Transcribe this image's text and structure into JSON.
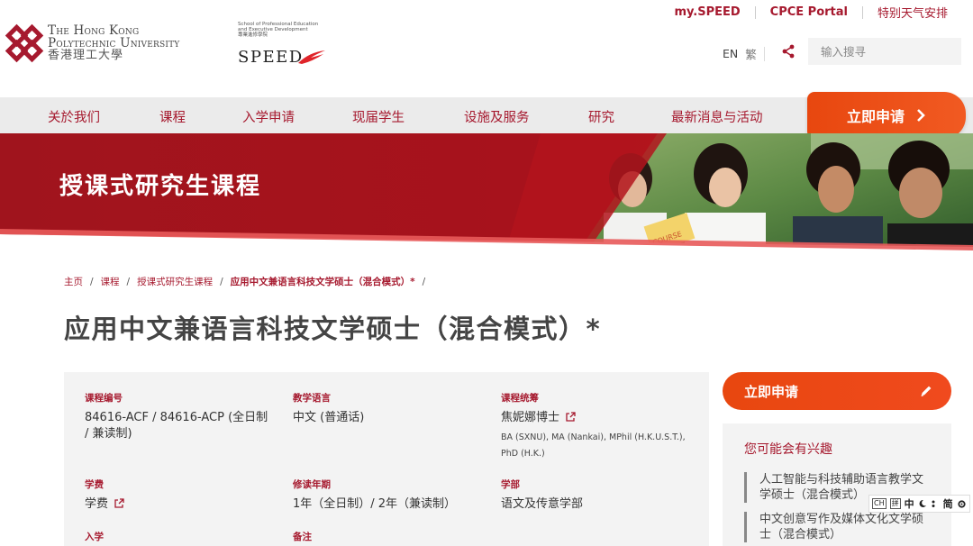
{
  "top_links": [
    "my.SPEED",
    "CPCE Portal",
    "特别天气安排"
  ],
  "logo": {
    "en_line1": "The Hong Kong",
    "en_line2": "Polytechnic University",
    "zh": "香港理工大學"
  },
  "speed": {
    "line1": "School of Professional Education",
    "line2": "and Executive Development",
    "line3": "專業進修學院",
    "word": "SPEED"
  },
  "lang": {
    "en": "EN",
    "zh": "繁"
  },
  "search": {
    "placeholder": "输入搜寻"
  },
  "nav": [
    "关於我们",
    "课程",
    "入学申请",
    "现届学生",
    "设施及服务",
    "研究",
    "最新消息与活动"
  ],
  "apply_tab": "立即申请",
  "banner": {
    "title": "授课式研究生课程",
    "book_text": "COURSE"
  },
  "breadcrumb": [
    "主页",
    "课程",
    "授课式研究生课程",
    "应用中文兼语言科技文学硕士（混合模式）*"
  ],
  "page_title": "应用中文兼语言科技文学硕士（混合模式）*",
  "info": {
    "code_label": "课程编号",
    "code_value": "84616-ACF / 84616-ACP (全日制 / 兼读制)",
    "lang_label": "教学语言",
    "lang_value": "中文 (普通话)",
    "leader_label": "课程统筹",
    "leader_value": "焦妮娜博士",
    "leader_quals": "BA (SXNU), MA (Nankai), MPhil (H.K.U.S.T.), PhD (H.K.)",
    "fee_label": "学费",
    "fee_value": "学费",
    "duration_label": "修读年期",
    "duration_value": "1年（全日制）/ 2年（兼读制）",
    "dept_label": "学部",
    "dept_value": "语文及传意学部",
    "intake_label": "入学",
    "remark_label": "备注"
  },
  "apply_button": "立即申请",
  "interest": {
    "title": "您可能会有兴趣",
    "items": [
      "人工智能与科技辅助语言教学文学硕士（混合模式）",
      "中文创意写作及媒体文化文学硕士（混合模式）"
    ]
  },
  "ime": {
    "box1": "CH",
    "box2": "拼",
    "lang": "中",
    "mode": "简"
  },
  "colors": {
    "brand": "#a6192e",
    "accent": "#f15a22"
  }
}
